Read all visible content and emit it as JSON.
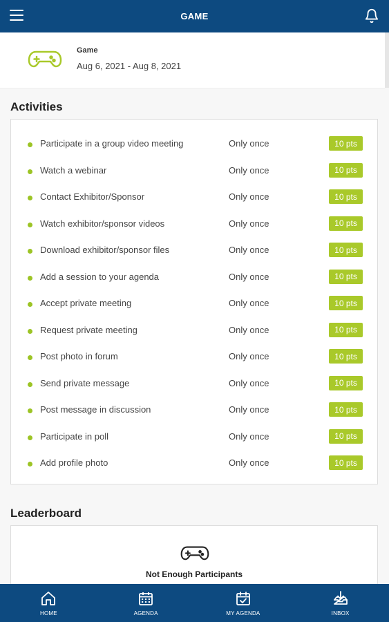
{
  "header": {
    "title": "GAME",
    "menu_icon": "hamburger-menu-icon",
    "notification_icon": "bell-icon"
  },
  "game": {
    "label": "Game",
    "dates": "Aug 6, 2021 - Aug 8, 2021",
    "icon": "gamepad-icon"
  },
  "activities": {
    "title": "Activities",
    "items": [
      {
        "label": "Participate in a group video meeting",
        "frequency": "Only once",
        "points": "10 pts"
      },
      {
        "label": "Watch a webinar",
        "frequency": "Only once",
        "points": "10 pts"
      },
      {
        "label": "Contact Exhibitor/Sponsor",
        "frequency": "Only once",
        "points": "10 pts"
      },
      {
        "label": "Watch exhibitor/sponsor videos",
        "frequency": "Only once",
        "points": "10 pts"
      },
      {
        "label": "Download exhibitor/sponsor files",
        "frequency": "Only once",
        "points": "10 pts"
      },
      {
        "label": "Add a session to your agenda",
        "frequency": "Only once",
        "points": "10 pts"
      },
      {
        "label": "Accept private meeting",
        "frequency": "Only once",
        "points": "10 pts"
      },
      {
        "label": "Request private meeting",
        "frequency": "Only once",
        "points": "10 pts"
      },
      {
        "label": "Post photo in forum",
        "frequency": "Only once",
        "points": "10 pts"
      },
      {
        "label": "Send private message",
        "frequency": "Only once",
        "points": "10 pts"
      },
      {
        "label": "Post message in discussion",
        "frequency": "Only once",
        "points": "10 pts"
      },
      {
        "label": "Participate in poll",
        "frequency": "Only once",
        "points": "10 pts"
      },
      {
        "label": "Add profile photo",
        "frequency": "Only once",
        "points": "10 pts"
      }
    ]
  },
  "leaderboard": {
    "title": "Leaderboard",
    "empty_message": "Not Enough Participants",
    "icon": "gamepad-icon"
  },
  "bottom_nav": [
    {
      "label": "HOME",
      "icon": "home-icon"
    },
    {
      "label": "AGENDA",
      "icon": "calendar-icon"
    },
    {
      "label": "MY AGENDA",
      "icon": "calendar-check-icon"
    },
    {
      "label": "INBOX",
      "icon": "inbox-download-icon"
    }
  ],
  "colors": {
    "primary": "#0d4a80",
    "accent": "#a9c92a",
    "bullet": "#9cc425"
  }
}
